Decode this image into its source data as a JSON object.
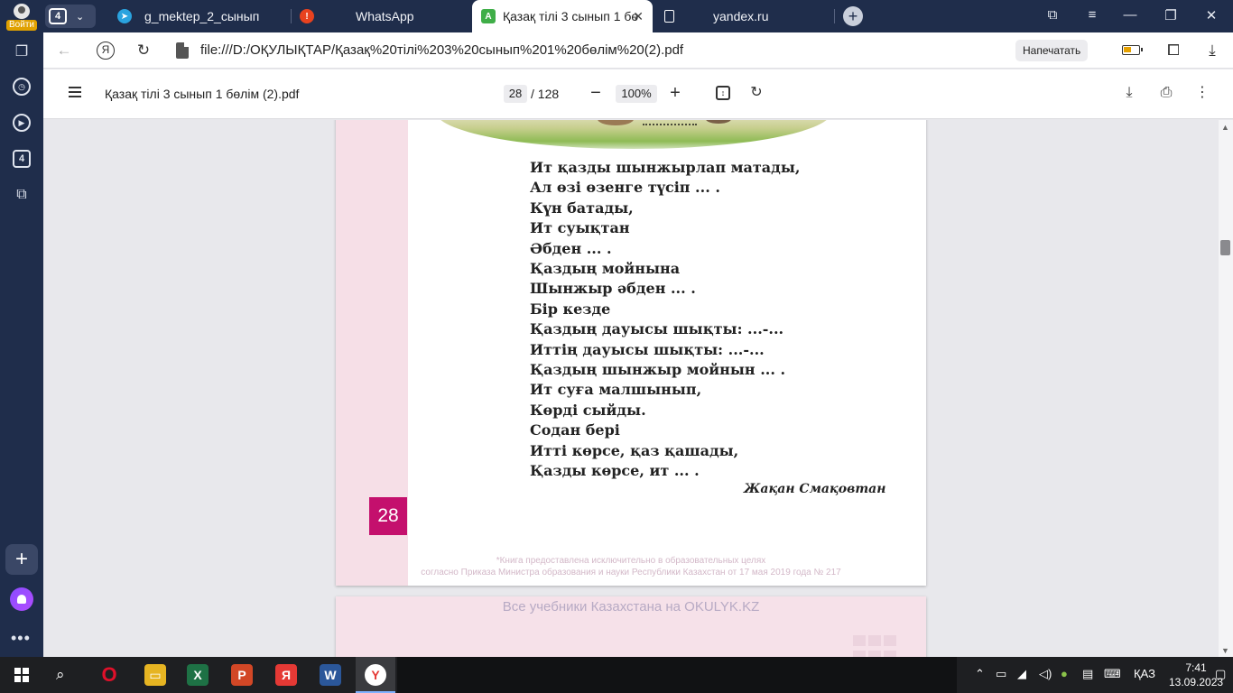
{
  "sidebar": {
    "login_label": "Войти",
    "tabs_badge": "4"
  },
  "tabs": {
    "counter": "4",
    "items": [
      {
        "label": "g_mektep_2_сынып",
        "icon": "telegram-icon",
        "color": "#2aa3df"
      },
      {
        "label": "WhatsApp",
        "icon": "alert-icon",
        "color": "#e8421f"
      },
      {
        "label": "Қазақ тілі 3 сынып 1 бө",
        "icon": "pdf-app-icon",
        "color": "#3fae48"
      },
      {
        "label": "yandex.ru",
        "icon": "page-icon",
        "color": "#ffffff"
      }
    ]
  },
  "address": {
    "url": "file:///D:/ОҚУЛЫҚТАР/Қазақ%20тілі%203%20сынып%201%20бөлім%20(2).pdf",
    "print_label": "Напечатать"
  },
  "pdf": {
    "title": "Қазақ тілі 3 сынып 1 бөлім (2).pdf",
    "current_page": "28",
    "total_pages": "/ 128",
    "zoom": "100%"
  },
  "page": {
    "poem_lines": [
      "Ит қазды шынжырлап матады,",
      "Ал өзі өзенге түсіп ... .",
      "Күн батады,",
      "Ит суықтан",
      "Әбден ... .",
      "Қаздың мойнына",
      "Шынжыр әбден ... .",
      "Бір кезде",
      "Қаздың дауысы шықты: ...-...",
      "Иттің дауысы шықты: ...-...",
      "Қаздың шынжыр мойнын ... .",
      "Ит суға малшынып,",
      "Көрді сыйды.",
      "Содан бері",
      "Итті көрсе, қаз қашады,",
      "Қазды көрсе, ит ... ."
    ],
    "author": "Жақан Смақовтан",
    "number": "28",
    "notice_line1": "*Книга предоставлена исключительно в образовательных целях",
    "notice_line2": "согласно Приказа Министра образования и науки Республики Казахстан от 17 мая 2019 года № 217",
    "next_page_watermark": "Все учебники Казахстана на OKULYK.KZ"
  },
  "taskbar": {
    "language": "ҚАЗ",
    "time": "7:41",
    "date": "13.09.2023"
  }
}
